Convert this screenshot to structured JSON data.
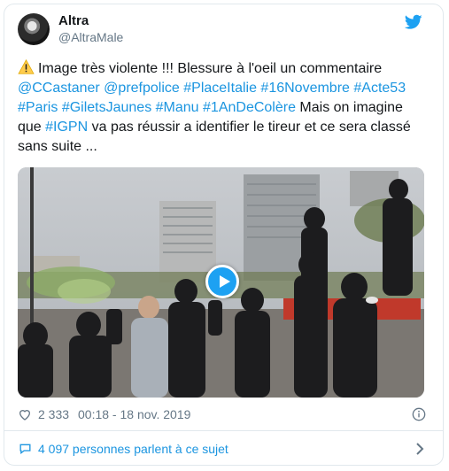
{
  "author": {
    "name": "Altra",
    "handle": "@AltraMale",
    "avatar_icon": "avatar-photo"
  },
  "tweet": {
    "warning_icon": "warning-icon",
    "lines": [
      [
        {
          "t": "Image très violente !!! Blessure à l'oeil un commentaire",
          "tag": false
        }
      ],
      [
        {
          "t": "@CCastaner",
          "tag": true
        },
        {
          "t": " ",
          "tag": false
        },
        {
          "t": "@prefpolice",
          "tag": true
        },
        {
          "t": " ",
          "tag": false
        },
        {
          "t": "#PlaceItalie",
          "tag": true
        },
        {
          "t": " ",
          "tag": false
        },
        {
          "t": "#16Novembre",
          "tag": true
        },
        {
          "t": " ",
          "tag": false
        },
        {
          "t": "#Acte53",
          "tag": true
        }
      ],
      [
        {
          "t": "#Paris",
          "tag": true
        },
        {
          "t": " ",
          "tag": false
        },
        {
          "t": "#GiletsJaunes",
          "tag": true
        },
        {
          "t": " ",
          "tag": false
        },
        {
          "t": "#Manu",
          "tag": true
        },
        {
          "t": " ",
          "tag": false
        },
        {
          "t": "#1AnDeColère",
          "tag": true
        },
        {
          "t": " Mais on imagine",
          "tag": false
        }
      ],
      [
        {
          "t": "que ",
          "tag": false
        },
        {
          "t": "#IGPN",
          "tag": true
        },
        {
          "t": " va pas réussir a identifier le tireur et ce sera classé",
          "tag": false
        }
      ],
      [
        {
          "t": "sans suite ...",
          "tag": false
        }
      ]
    ]
  },
  "media": {
    "type": "video",
    "play_icon": "play-icon"
  },
  "meta": {
    "likes": "2 333",
    "timestamp": "00:18 - 18 nov. 2019"
  },
  "conversation": {
    "label": "4 097 personnes parlent à ce sujet"
  },
  "colors": {
    "link": "#1b95e0",
    "twitter_blue": "#1da1f2",
    "text": "#14171a",
    "secondary": "#657786",
    "border": "#e1e8ed"
  }
}
